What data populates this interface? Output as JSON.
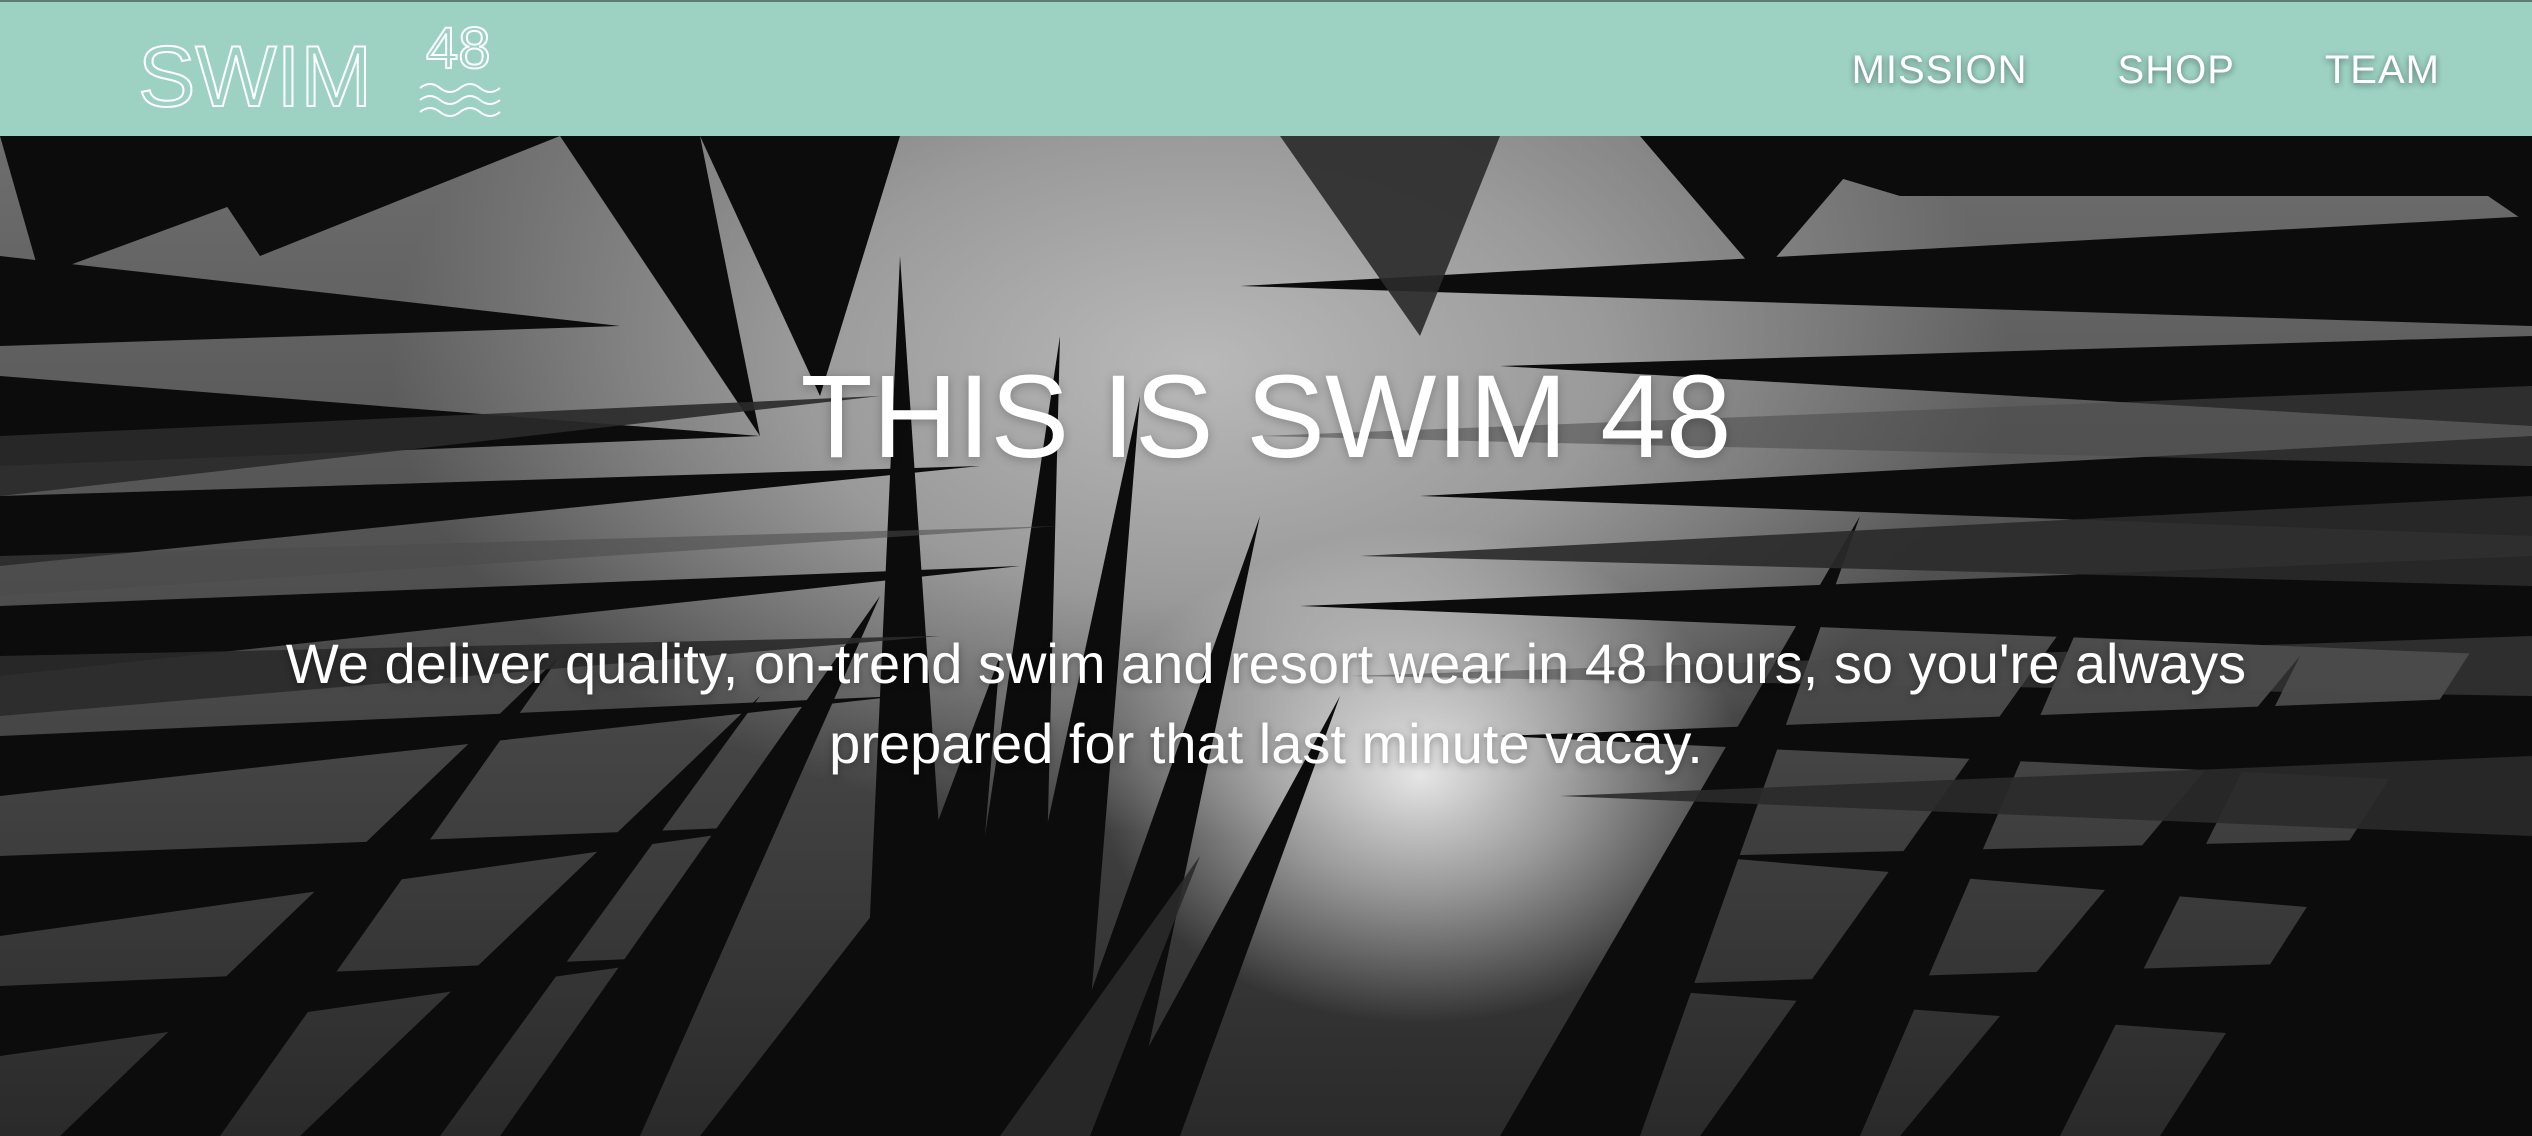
{
  "header": {
    "logo": {
      "text": "SWIM",
      "number": "48",
      "icon": "wave-lines-icon"
    },
    "nav": [
      {
        "label": "MISSION"
      },
      {
        "label": "SHOP"
      },
      {
        "label": "TEAM"
      }
    ]
  },
  "hero": {
    "title": "THIS IS SWIM 48",
    "text": "We deliver quality, on-trend swim and resort wear in 48 hours, so you're always prepared for that last minute vacay.",
    "background": "palm-leaves-photo"
  },
  "colors": {
    "nav_background": "#9dd2c2",
    "text": "#ffffff"
  }
}
